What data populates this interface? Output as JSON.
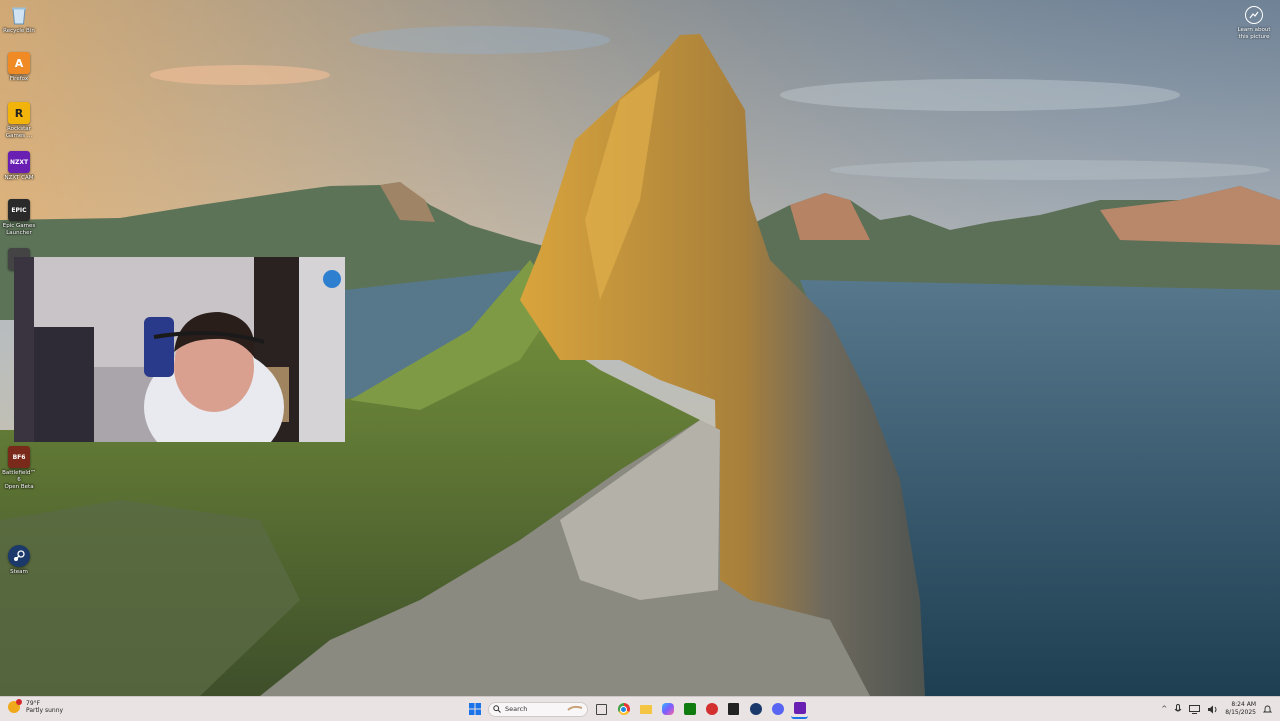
{
  "desktop": {
    "icons": [
      {
        "label": "Recycle Bin",
        "icon": "recycle-bin-icon",
        "glyph": "",
        "color": "#8fb8d8"
      },
      {
        "label": "Firefox",
        "icon": "app-icon",
        "glyph": "A",
        "color": "#f08a24"
      },
      {
        "label": "Rockstar\nGames ...",
        "icon": "rockstar-icon",
        "glyph": "R",
        "color": "#f2b30a"
      },
      {
        "label": "NZXT CAM",
        "icon": "nzxt-cam-icon",
        "glyph": "NZXT",
        "color": "#6a1fb3"
      },
      {
        "label": "Epic Games\nLauncher",
        "icon": "epic-games-icon",
        "glyph": "EPIC",
        "color": "#2a2a2a"
      },
      {
        "label": "Battlefield™ 6\nOpen Beta",
        "icon": "battlefield-icon",
        "glyph": "BF6",
        "color": "#7a2a1a"
      },
      {
        "label": "Steam",
        "icon": "steam-icon",
        "glyph": "",
        "color": "#1b3a6b"
      }
    ],
    "spotlight": {
      "label": "Learn about\nthis picture",
      "icon": "camera-icon"
    }
  },
  "taskbar": {
    "weather": {
      "temp": "79°F",
      "condition": "Partly sunny"
    },
    "search_placeholder": "Search",
    "pinned": [
      {
        "icon": "task-view-icon",
        "color": "#444444"
      },
      {
        "icon": "chrome-icon",
        "color": "#e53935"
      },
      {
        "icon": "file-explorer-icon",
        "color": "#f4c542"
      },
      {
        "icon": "copilot-icon",
        "color": "#7b5cff"
      },
      {
        "icon": "xbox-icon",
        "color": "#107c10"
      },
      {
        "icon": "rockstar-launcher-icon",
        "color": "#d32f2f"
      },
      {
        "icon": "epic-games-launcher-icon",
        "color": "#222222"
      },
      {
        "icon": "steam-taskbar-icon",
        "color": "#1b3a6b"
      },
      {
        "icon": "discord-icon",
        "color": "#5865f2"
      },
      {
        "icon": "nzxt-taskbar-icon",
        "color": "#6a1fb3"
      }
    ],
    "clock": {
      "time": "8:24 AM",
      "date": "8/15/2025"
    }
  }
}
